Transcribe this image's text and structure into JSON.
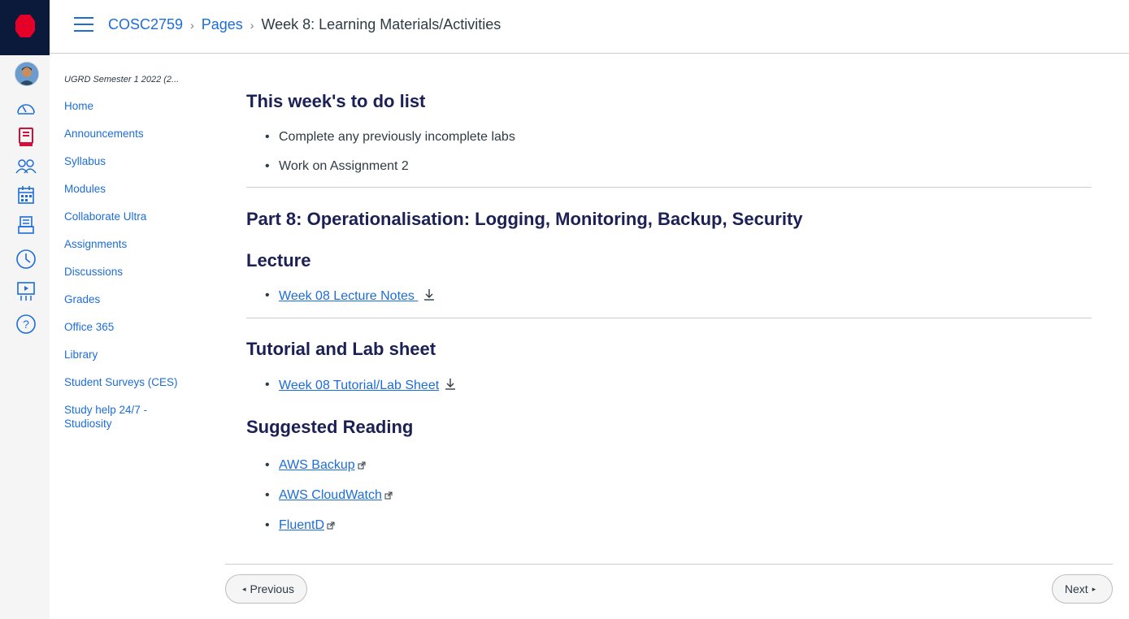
{
  "header": {
    "course_code": "COSC2759",
    "crumb_pages": "Pages",
    "current_page": "Week 8: Learning Materials/Activities",
    "sep1": "›",
    "sep2": "›"
  },
  "course_nav": {
    "term": "UGRD Semester 1 2022 (2...",
    "items": [
      "Home",
      "Announcements",
      "Syllabus",
      "Modules",
      "Collaborate Ultra",
      "Assignments",
      "Discussions",
      "Grades",
      "Office 365",
      "Library",
      "Student Surveys (CES)",
      "Study help 24/7 - Studiosity"
    ]
  },
  "content": {
    "todo_heading": "This week's to do list",
    "todo_items": [
      "Complete any previously incomplete labs",
      "Work on Assignment 2"
    ],
    "part_heading": "Part 8:  Operationalisation: Logging, Monitoring, Backup, Security",
    "lecture_heading": "Lecture",
    "lecture_link": "Week 08 Lecture Notes ",
    "tutorial_heading": "Tutorial and Lab sheet",
    "tutorial_link": "Week 08 Tutorial/Lab Sheet",
    "reading_heading": "Suggested Reading",
    "reading_links": [
      "AWS Backup",
      "AWS CloudWatch",
      "FluentD"
    ]
  },
  "footer": {
    "previous_label": "Previous",
    "next_label": "Next",
    "prev_arrow": "◂",
    "next_arrow": "▸"
  },
  "colors": {
    "link": "#1c6dd8",
    "heading": "#1b2055",
    "rail_bg": "#f5f5f5",
    "logo_bg": "#0b1a3a",
    "logo_red": "#e60028",
    "active_icon": "#d0103a"
  },
  "icons": {
    "rail": [
      "rmit-logo",
      "account-avatar",
      "dashboard-icon",
      "courses-icon",
      "groups-icon",
      "calendar-icon",
      "inbox-icon",
      "history-icon",
      "studio-icon",
      "help-icon"
    ]
  }
}
